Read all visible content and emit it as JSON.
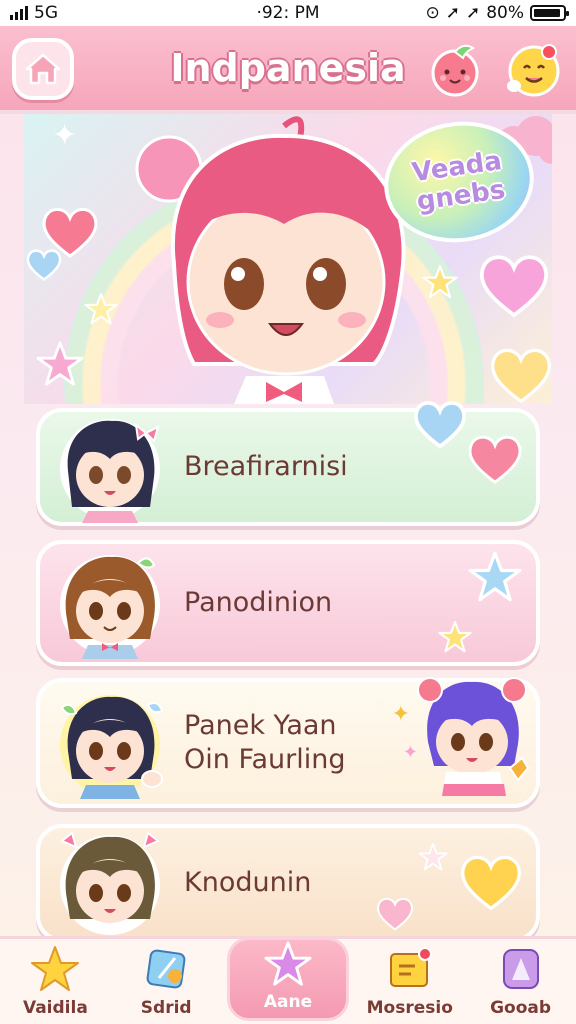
{
  "status_bar": {
    "network": "5G",
    "time": "·92: PM",
    "battery": "80%"
  },
  "header": {
    "title": "Indpanesia"
  },
  "hero": {
    "bubble_text": [
      "Veada",
      "gnebs"
    ]
  },
  "cards": [
    {
      "label": "Breafirarnisi"
    },
    {
      "label": "Panodinion"
    },
    {
      "label_line1": "Panek Yaan",
      "label_line2": "Oin Faurling"
    },
    {
      "label": "Knodunin"
    }
  ],
  "nav": [
    {
      "label": "Vaidila",
      "icon": "star-icon"
    },
    {
      "label": "Sdrid",
      "icon": "gem-icon"
    },
    {
      "label": "Aane",
      "icon": "sparkle-star-icon",
      "active": true
    },
    {
      "label": "Mosresio",
      "icon": "message-icon"
    },
    {
      "label": "Gooab",
      "icon": "crystal-icon"
    }
  ],
  "colors": {
    "header": "#f6a6bb",
    "title_outline": "#d9708f",
    "label_text": "#6b3a34",
    "nav_active": "#f49ab2"
  }
}
